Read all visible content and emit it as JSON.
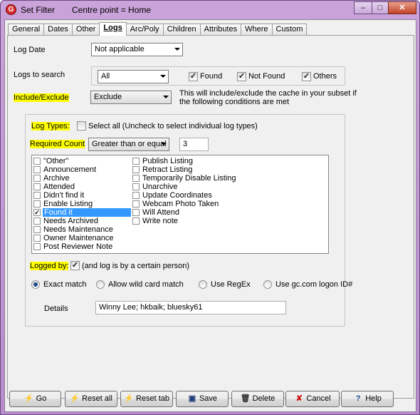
{
  "window": {
    "title": "Set Filter",
    "subtitle": "Centre point = Home",
    "app_icon": "gsak-icon",
    "controls": {
      "minimize": "–",
      "maximize": "□",
      "close": "✕"
    }
  },
  "tabs": [
    "General",
    "Dates",
    "Other",
    "Logs",
    "Arc/Poly",
    "Children",
    "Attributes",
    "Where",
    "Custom"
  ],
  "active_tab": "Logs",
  "log_date": {
    "label": "Log Date",
    "value": "Not applicable"
  },
  "logs_to_search": {
    "label": "Logs to search",
    "value": "All",
    "found": {
      "label": "Found",
      "checked": "✓"
    },
    "not_found": {
      "label": "Not Found",
      "checked": "✓"
    },
    "others": {
      "label": "Others",
      "checked": "✓"
    }
  },
  "include_exclude": {
    "label": "Include/Exclude",
    "value": "Exclude",
    "note_line1": "This will include/exclude the cache in your subset if",
    "note_line2": "the following conditions are met"
  },
  "log_types": {
    "label": "Log Types:",
    "select_all": "Select all (Uncheck to select individual log types)"
  },
  "required_count": {
    "label": "Required Count",
    "operator": "Greater than or equal",
    "value": "3"
  },
  "log_type_list": {
    "col1": [
      {
        "label": "\"Other\"",
        "mark": ""
      },
      {
        "label": "Announcement",
        "mark": ""
      },
      {
        "label": "Archive",
        "mark": ""
      },
      {
        "label": "Attended",
        "mark": ""
      },
      {
        "label": "Didn't find it",
        "mark": ""
      },
      {
        "label": "Enable Listing",
        "mark": ""
      },
      {
        "label": "Found it",
        "mark": "✓"
      },
      {
        "label": "Needs Archived",
        "mark": ""
      },
      {
        "label": "Needs Maintenance",
        "mark": ""
      },
      {
        "label": "Owner Maintenance",
        "mark": ""
      },
      {
        "label": "Post Reviewer Note",
        "mark": ""
      }
    ],
    "col2": [
      {
        "label": "Publish Listing",
        "mark": ""
      },
      {
        "label": "Retract Listing",
        "mark": ""
      },
      {
        "label": "Temporarily Disable Listing",
        "mark": ""
      },
      {
        "label": "Unarchive",
        "mark": ""
      },
      {
        "label": "Update Coordinates",
        "mark": ""
      },
      {
        "label": "Webcam Photo Taken",
        "mark": ""
      },
      {
        "label": "Will Attend",
        "mark": ""
      },
      {
        "label": "Write note",
        "mark": ""
      }
    ]
  },
  "logged_by": {
    "label": "Logged by:",
    "checkbox_label": "(and log is by a certain person)",
    "checked": "✓",
    "match_options": [
      "Exact match",
      "Allow wild card match",
      "Use RegEx",
      "Use gc.com logon ID#"
    ],
    "selected_option": "Exact match",
    "details_label": "Details",
    "details_value": "Winny Lee; hkbaik; bluesky61"
  },
  "buttons": {
    "go": "Go",
    "reset_all": "Reset all",
    "reset_tab": "Reset tab",
    "save": "Save",
    "delete": "Delete",
    "cancel": "Cancel",
    "help": "Help"
  },
  "colors": {
    "highlight": "#ffff00",
    "selection": "#3399ff",
    "title_bar": "#c9a3d9"
  }
}
